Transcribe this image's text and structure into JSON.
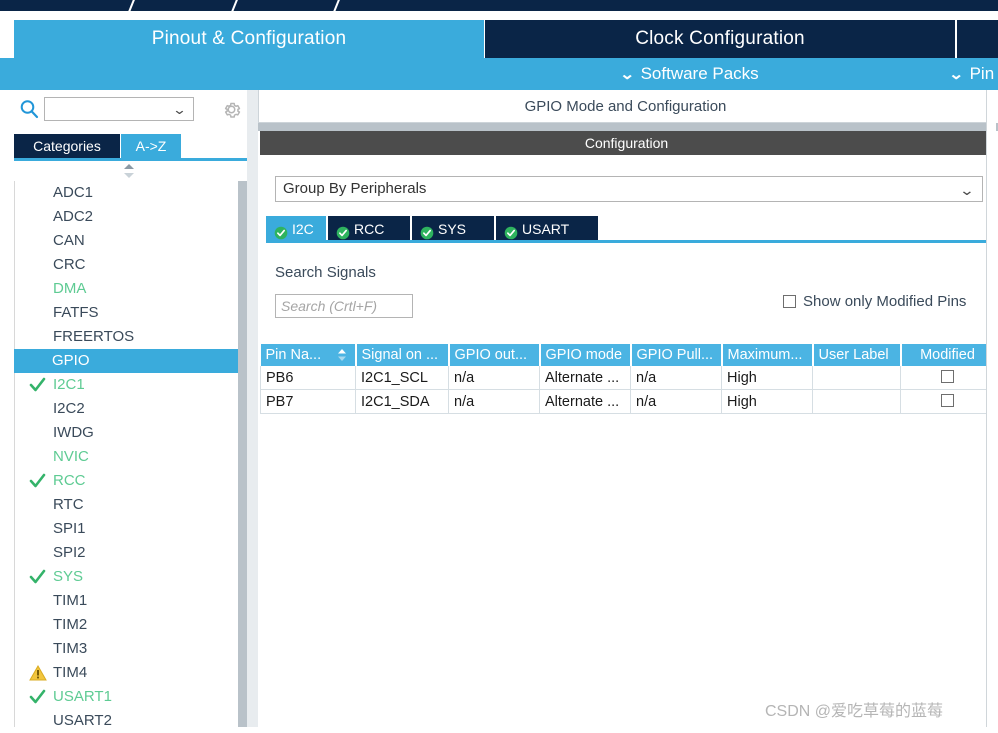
{
  "header": {
    "tabs": [
      {
        "label": "Pinout & Configuration",
        "active": true
      },
      {
        "label": "Clock Configuration",
        "active": false
      },
      {
        "label": "",
        "active": false
      }
    ],
    "subbar": {
      "software_packs": "Software Packs",
      "pinout": "Pin",
      "chevron": "⌄"
    }
  },
  "sidebar": {
    "search": {
      "value": "",
      "dropdown_arrow": "⌄"
    },
    "gear_tooltip": "Settings",
    "tabs": [
      {
        "label": "Categories",
        "selected": true
      },
      {
        "label": "A->Z",
        "selected": false
      }
    ],
    "items": [
      {
        "label": "ADC1",
        "state": "none",
        "mark": "none"
      },
      {
        "label": "ADC2",
        "state": "none",
        "mark": "none"
      },
      {
        "label": "CAN",
        "state": "none",
        "mark": "none"
      },
      {
        "label": "CRC",
        "state": "none",
        "mark": "none"
      },
      {
        "label": "DMA",
        "state": "green",
        "mark": "none"
      },
      {
        "label": "FATFS",
        "state": "none",
        "mark": "none"
      },
      {
        "label": "FREERTOS",
        "state": "none",
        "mark": "none"
      },
      {
        "label": "GPIO",
        "state": "selected",
        "mark": "none"
      },
      {
        "label": "I2C1",
        "state": "green",
        "mark": "check"
      },
      {
        "label": "I2C2",
        "state": "none",
        "mark": "none"
      },
      {
        "label": "IWDG",
        "state": "none",
        "mark": "none"
      },
      {
        "label": "NVIC",
        "state": "green",
        "mark": "none"
      },
      {
        "label": "RCC",
        "state": "green",
        "mark": "check"
      },
      {
        "label": "RTC",
        "state": "none",
        "mark": "none"
      },
      {
        "label": "SPI1",
        "state": "none",
        "mark": "none"
      },
      {
        "label": "SPI2",
        "state": "none",
        "mark": "none"
      },
      {
        "label": "SYS",
        "state": "green",
        "mark": "check"
      },
      {
        "label": "TIM1",
        "state": "none",
        "mark": "none"
      },
      {
        "label": "TIM2",
        "state": "none",
        "mark": "none"
      },
      {
        "label": "TIM3",
        "state": "none",
        "mark": "none"
      },
      {
        "label": "TIM4",
        "state": "none",
        "mark": "warn"
      },
      {
        "label": "USART1",
        "state": "green",
        "mark": "check"
      },
      {
        "label": "USART2",
        "state": "none",
        "mark": "none"
      }
    ]
  },
  "main": {
    "mode_title": "GPIO Mode and Configuration",
    "configuration_banner": "Configuration",
    "group_by": {
      "value": "Group By Peripherals",
      "arrow": "⌄"
    },
    "peripheral_tabs": [
      {
        "label": "I2C",
        "active": true
      },
      {
        "label": "RCC",
        "active": false
      },
      {
        "label": "SYS",
        "active": false
      },
      {
        "label": "USART",
        "active": false
      }
    ],
    "search_signals_label": "Search Signals",
    "search_signals": {
      "value": "",
      "placeholder": "Search (Crtl+F)"
    },
    "show_only_modified": {
      "label": "Show only Modified Pins",
      "checked": false
    },
    "table": {
      "columns": [
        "Pin Na...",
        "Signal on ...",
        "GPIO out...",
        "GPIO mode",
        "GPIO Pull...",
        "Maximum...",
        "User Label",
        "Modified"
      ],
      "sorted_column": 0,
      "rows": [
        {
          "pin_name": "PB6",
          "signal_on": "I2C1_SCL",
          "gpio_output": "n/a",
          "gpio_mode": "Alternate ...",
          "gpio_pull": "n/a",
          "maximum": "High",
          "user_label": "",
          "modified": false
        },
        {
          "pin_name": "PB7",
          "signal_on": "I2C1_SDA",
          "gpio_output": "n/a",
          "gpio_mode": "Alternate ...",
          "gpio_pull": "n/a",
          "maximum": "High",
          "user_label": "",
          "modified": false
        }
      ]
    }
  },
  "watermark": "CSDN @爱吃草莓的蓝莓",
  "colors": {
    "accent_blue": "#3aabdc",
    "dark_navy": "#0a2547",
    "header_blue": "#4bb4e3",
    "green": "#5ecb93",
    "warn_yellow": "#f2c53d",
    "banner_grey": "#4c4c4c"
  }
}
